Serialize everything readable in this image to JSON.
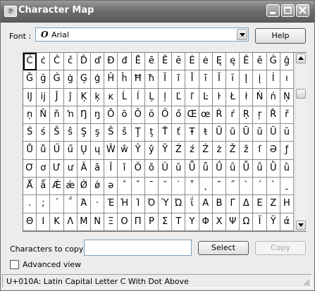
{
  "window": {
    "title": "Character Map"
  },
  "font": {
    "label": "Font :",
    "value": "Arial",
    "icon": "opentype-font-icon"
  },
  "help_label": "Help",
  "grid": {
    "selected_index": 0,
    "rows": [
      [
        "Ċ",
        "ċ",
        "Č",
        "č",
        "Ď",
        "ď",
        "Đ",
        "đ",
        "Ē",
        "ē",
        "Ĕ",
        "ĕ",
        "Ė",
        "ė",
        "Ę",
        "ę",
        "Ě",
        "ě",
        "Ĝ",
        "ĝ"
      ],
      [
        "Ğ",
        "ğ",
        "Ġ",
        "ġ",
        "Ģ",
        "ģ",
        "Ĥ",
        "ĥ",
        "Ħ",
        "ħ",
        "Ĩ",
        "ĩ",
        "Ī",
        "ī",
        "Ĭ",
        "ĭ",
        "Į",
        "į",
        "İ",
        "ı"
      ],
      [
        "Ĳ",
        "ĳ",
        "Ĵ",
        "ĵ",
        "Ķ",
        "ķ",
        "ĸ",
        "Ĺ",
        "ĺ",
        "Ļ",
        "ļ",
        "Ľ",
        "ľ",
        "Ŀ",
        "ŀ",
        "Ł",
        "ł",
        "Ń",
        "ń",
        "Ņ"
      ],
      [
        "ņ",
        "Ň",
        "ň",
        "ŉ",
        "Ŋ",
        "ŋ",
        "Ō",
        "ō",
        "Ŏ",
        "ŏ",
        "Ő",
        "ő",
        "Œ",
        "œ",
        "Ŕ",
        "ŕ",
        "Ŗ",
        "ŗ",
        "Ř",
        "ř"
      ],
      [
        "Ś",
        "ś",
        "Ŝ",
        "ŝ",
        "Ş",
        "ş",
        "Š",
        "š",
        "Ţ",
        "ţ",
        "Ť",
        "ť",
        "Ŧ",
        "ŧ",
        "Ũ",
        "ũ",
        "Ū",
        "ū",
        "Ŭ",
        "ŭ"
      ],
      [
        "Ů",
        "ů",
        "Ű",
        "ű",
        "Ų",
        "ų",
        "Ŵ",
        "ŵ",
        "Ŷ",
        "ŷ",
        "Ÿ",
        "Ź",
        "ź",
        "Ż",
        "ż",
        "Ž",
        "ž",
        "ſ",
        "Ə",
        "ƒ"
      ],
      [
        "Ơ",
        "ơ",
        "Ư",
        "ư",
        "Ǎ",
        "ǎ",
        "Ǐ",
        "ǐ",
        "Ǒ",
        "ǒ",
        "Ǔ",
        "ǔ",
        "Ǖ",
        "ǖ",
        "Ǘ",
        "ǘ",
        "Ǚ",
        "ǚ",
        "Ǜ",
        "ǜ"
      ],
      [
        "Ǻ",
        "ǻ",
        "Ǽ",
        "ǽ",
        "Ǿ",
        "ǿ",
        "ə",
        "ˆ",
        "ˇ",
        "ˉ",
        "˘",
        "˙",
        "˚",
        "˛",
        "˜",
        "˝",
        "ˋ",
        "ˊ",
        "ˋ",
        "ˍ"
      ],
      [
        ".",
        ";",
        "΄",
        "΅",
        "Ά",
        "·",
        "Έ",
        "Ή",
        "Ί",
        "Ό",
        "Ύ",
        "Ώ",
        "ΐ",
        "Α",
        "Β",
        "Γ",
        "Δ",
        "Ε",
        "Ζ",
        "Η"
      ],
      [
        "Θ",
        "Ι",
        "Κ",
        "Λ",
        "Μ",
        "Ν",
        "Ξ",
        "Ο",
        "Π",
        "Ρ",
        "Σ",
        "Τ",
        "Υ",
        "Φ",
        "Χ",
        "Ψ",
        "Ω",
        "Ϊ",
        "Ϋ",
        "ά"
      ]
    ]
  },
  "copy": {
    "label": "Characters to copy :",
    "value": "",
    "select_label": "Select",
    "copy_label": "Copy"
  },
  "advanced": {
    "label": "Advanced view",
    "checked": false
  },
  "status": {
    "text": "U+010A: Latin Capital Letter C With Dot Above"
  }
}
